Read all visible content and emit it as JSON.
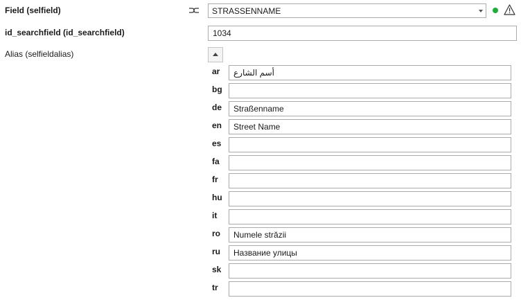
{
  "field": {
    "label": "Field (selfield)",
    "value": "STRASSENNAME",
    "status_color": "#1fae3a",
    "link_icon": "link-icon",
    "warning_icon": "warning-icon"
  },
  "searchfield": {
    "label": "id_searchfield (id_searchfield)",
    "value": "1034"
  },
  "alias": {
    "label": "Alias (selfieldalias)",
    "collapse_icon": "collapse-up-icon",
    "entries": [
      {
        "code": "ar",
        "value": "أسم الشارع"
      },
      {
        "code": "bg",
        "value": ""
      },
      {
        "code": "de",
        "value": "Straßenname"
      },
      {
        "code": "en",
        "value": "Street Name"
      },
      {
        "code": "es",
        "value": ""
      },
      {
        "code": "fa",
        "value": ""
      },
      {
        "code": "fr",
        "value": ""
      },
      {
        "code": "hu",
        "value": ""
      },
      {
        "code": "it",
        "value": ""
      },
      {
        "code": "ro",
        "value": "Numele străzii"
      },
      {
        "code": "ru",
        "value": "Название улицы"
      },
      {
        "code": "sk",
        "value": ""
      },
      {
        "code": "tr",
        "value": ""
      }
    ]
  }
}
